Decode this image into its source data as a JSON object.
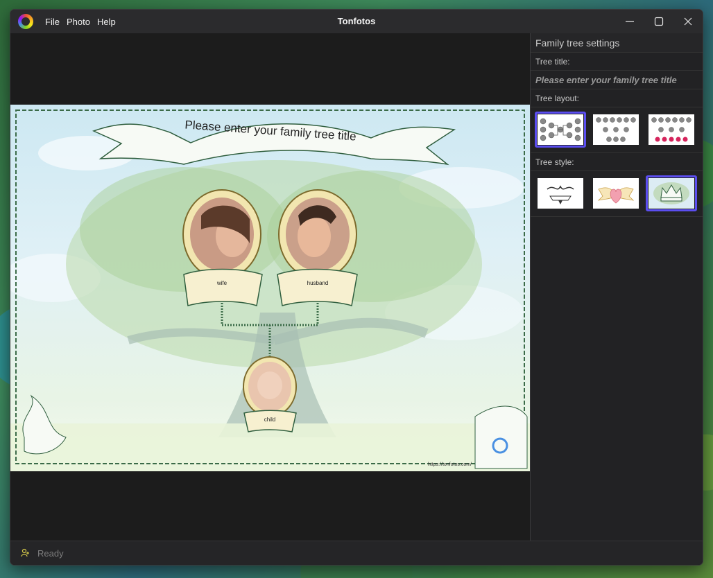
{
  "app": {
    "title": "Tonfotos",
    "menu": [
      "File",
      "Photo",
      "Help"
    ]
  },
  "canvas": {
    "tree_title": "Please enter your family tree title",
    "labels": {
      "wife": "wife",
      "husband": "husband",
      "child": "child"
    },
    "watermark": "https://tonfotos.com/"
  },
  "panel": {
    "header": "Family tree settings",
    "tree_title_label": "Tree title:",
    "tree_title_placeholder": "Please enter your family tree title",
    "tree_layout_label": "Tree layout:",
    "tree_style_label": "Tree style:"
  },
  "status": {
    "text": "Ready"
  },
  "colors": {
    "accent": "#5b4ef0",
    "bg": "#1d1d1f",
    "panel": "#222224"
  }
}
